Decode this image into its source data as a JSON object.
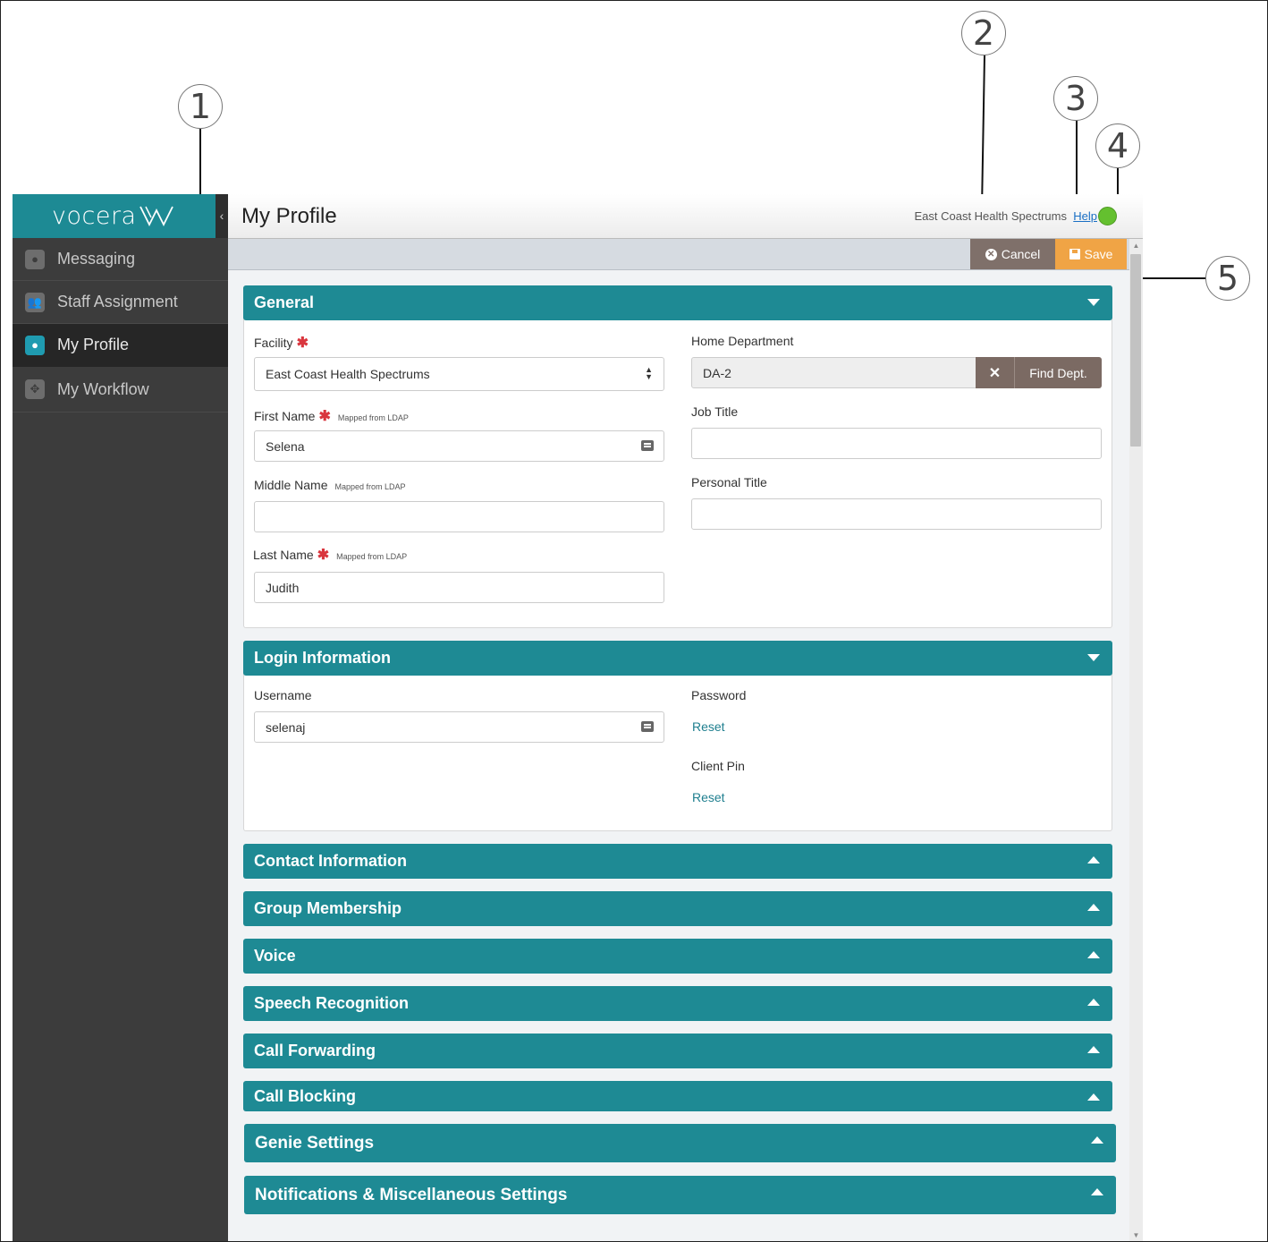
{
  "callouts": [
    "1",
    "2",
    "3",
    "4",
    "5"
  ],
  "sidebar": {
    "brand": "vocera",
    "collapse_icon": "chevron-left-icon",
    "items": [
      {
        "label": "Messaging",
        "icon": "chat-bubble-icon"
      },
      {
        "label": "Staff Assignment",
        "icon": "staff-icon"
      },
      {
        "label": "My Profile",
        "icon": "user-icon"
      },
      {
        "label": "My Workflow",
        "icon": "workflow-icon"
      }
    ]
  },
  "header": {
    "title": "My Profile",
    "facility": "East Coast Health Spectrums",
    "help": "Help",
    "status_color": "#64c02f"
  },
  "toolbar": {
    "cancel_label": "Cancel",
    "save_label": "Save"
  },
  "general": {
    "title": "General",
    "facility_label": "Facility",
    "facility_value": "East Coast Health Spectrums",
    "home_dept_label": "Home Department",
    "home_dept_value": "DA-2",
    "clear_icon": "✕",
    "find_dept": "Find Dept.",
    "first_name_label": "First Name",
    "first_name_value": "Selena",
    "job_title_label": "Job Title",
    "middle_name_label": "Middle Name",
    "personal_title_label": "Personal Title",
    "last_name_label": "Last Name",
    "last_name_value": "Judith",
    "ldap_note": "Mapped from LDAP",
    "required_mark": "✱"
  },
  "login": {
    "title": "Login Information",
    "username_label": "Username",
    "username_value": "selenaj",
    "password_label": "Password",
    "password_reset": "Reset",
    "pin_label": "Client Pin",
    "pin_reset": "Reset"
  },
  "collapsed_sections": [
    "Contact Information",
    "Group Membership",
    "Voice",
    "Speech Recognition",
    "Call Forwarding",
    "Call Blocking",
    "Genie Settings",
    "Notifications & Miscellaneous Settings"
  ]
}
